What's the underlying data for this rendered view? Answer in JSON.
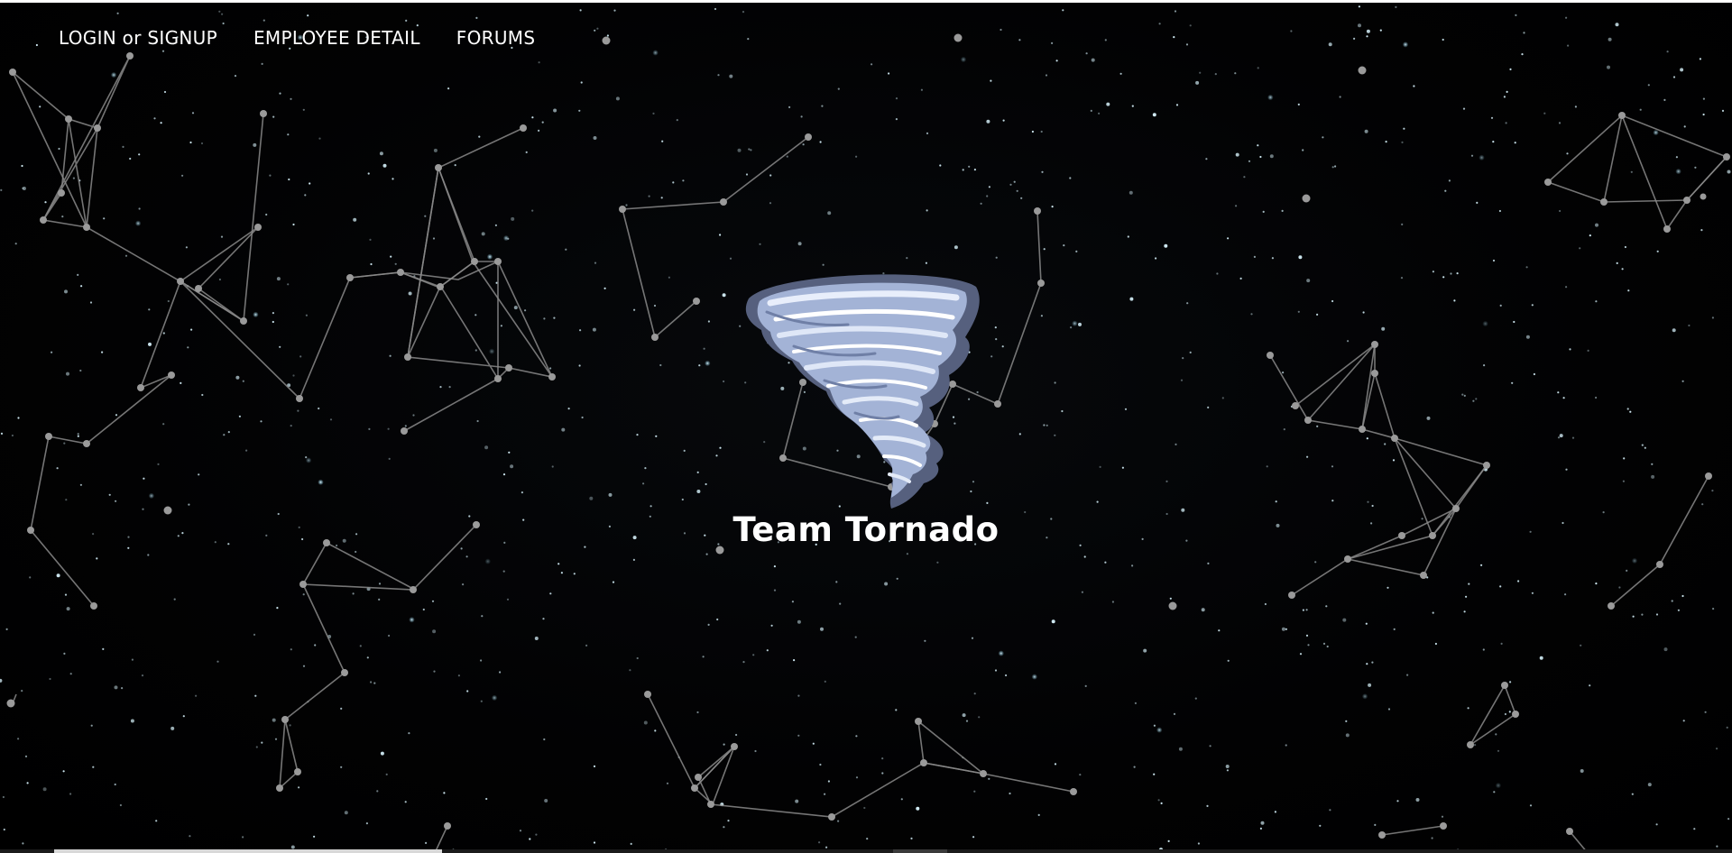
{
  "nav": {
    "items": [
      {
        "label": "LOGIN or SIGNUP"
      },
      {
        "label": "EMPLOYEE DETAIL"
      },
      {
        "label": "FORUMS"
      }
    ]
  },
  "hero": {
    "logo_icon": "tornado-icon",
    "title": "Team Tornado"
  },
  "background": {
    "description_icon": "starfield-constellations",
    "color": "#000000",
    "line_color": "#8a8a8a",
    "star_color": "#cfe9f2"
  }
}
